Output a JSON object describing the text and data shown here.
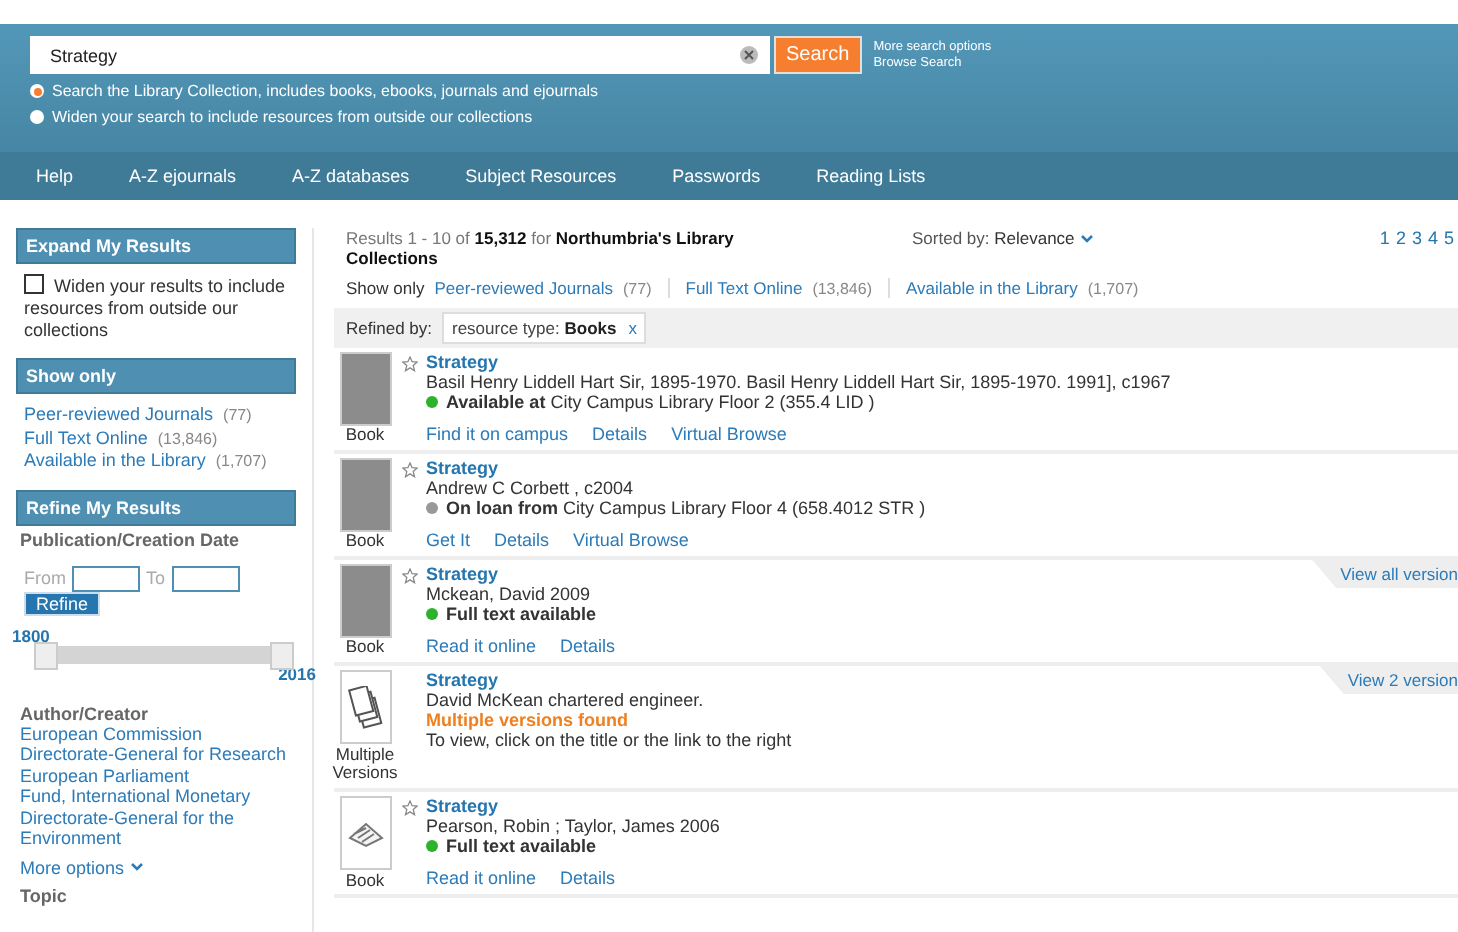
{
  "search": {
    "value": "Strategy",
    "button": "Search",
    "links": [
      "More search options",
      "Browse Search"
    ],
    "scopes": [
      {
        "label": "Search the Library Collection, includes books, ebooks, journals and ejournals",
        "selected": true
      },
      {
        "label": "Widen your search to include resources from outside our collections",
        "selected": false
      }
    ]
  },
  "nav": [
    "Help",
    "A-Z ejournals",
    "A-Z databases",
    "Subject Resources",
    "Passwords",
    "Reading Lists"
  ],
  "sidebar": {
    "expand": {
      "title": "Expand My Results",
      "checkbox": {
        "label": "Widen your results to include resources from outside our collections",
        "checked": false
      }
    },
    "show_only": {
      "title": "Show only",
      "items": [
        {
          "label": "Peer-reviewed Journals",
          "count": "(77)"
        },
        {
          "label": "Full Text Online",
          "count": "(13,846)"
        },
        {
          "label": "Available in the Library",
          "count": "(1,707)"
        }
      ]
    },
    "refine": {
      "title": "Refine My Results",
      "date_title": "Publication/Creation Date",
      "from": "From",
      "to": "To",
      "button": "Refine",
      "range_start": "1800",
      "range_end": "2016",
      "thumbs": [
        {
          "level": 0
        },
        {
          "level": 1
        }
      ]
    },
    "author": {
      "title": "Author/Creator",
      "items": [
        "European Commission",
        "Directorate-General for Research",
        "European Parliament",
        "Fund, International Monetary",
        "Directorate-General for the Environment"
      ],
      "more": "More options"
    },
    "next_title": "Topic"
  },
  "results": {
    "summary": "Results 1 - 10 of **15,312**  for **Northumbria's Library Collections**",
    "sort_label": "Sorted by:",
    "sort_value": "Relevance",
    "pages": [
      "1",
      "2",
      "3",
      "4",
      "5"
    ],
    "show_only_label": "Show only",
    "show_only": [
      {
        "label": "Peer-reviewed Journals",
        "count": "(77)"
      },
      {
        "label": "Full Text Online",
        "count": "(13,846)"
      },
      {
        "label": "Available in the Library",
        "count": "(1,707)"
      }
    ],
    "refined_label": "Refined by:",
    "refined_tag": "resource type: **Books**",
    "refined_remove": "x",
    "items": [
      {
        "kind": "cover",
        "type": "Book",
        "title": "Strategy",
        "author": "Basil Henry Liddell Hart Sir, 1895-1970. Basil Henry Liddell Hart Sir, 1895-1970. 1991], c1967",
        "status": {
          "kind": "available",
          "bold": "Available at",
          "text": "City Campus Library Floor 2 (355.4 LID )"
        },
        "links": [
          "Find it on campus",
          "Details",
          "Virtual Browse"
        ]
      },
      {
        "kind": "cover",
        "type": "Book",
        "title": "Strategy",
        "author": "Andrew C Corbett , c2004",
        "status": {
          "kind": "loan",
          "bold": "On loan from",
          "text": "City Campus Library Floor 4 (658.4012 STR )"
        },
        "links": [
          "Get It",
          "Details",
          "Virtual Browse"
        ]
      },
      {
        "kind": "cover",
        "type": "Book",
        "title": "Strategy",
        "author": "Mckean, David 2009",
        "status": {
          "kind": "available",
          "bold": "Full text available"
        },
        "links": [
          "Read it online",
          "Details"
        ],
        "versions": "View all version"
      },
      {
        "kind": "versions",
        "type": "Multiple Versions",
        "title": "Strategy",
        "author": "David McKean chartered engineer.",
        "status": {
          "kind": "multiple",
          "bold": "Multiple versions found",
          "text": "To view, click on the title or the link to the right"
        },
        "versions": "View 2 version"
      },
      {
        "kind": "book",
        "type": "Book",
        "title": "Strategy",
        "author": "Pearson, Robin ; Taylor, James 2006",
        "status": {
          "kind": "available",
          "bold": "Full text available"
        },
        "links": [
          "Read it online",
          "Details"
        ]
      }
    ]
  }
}
